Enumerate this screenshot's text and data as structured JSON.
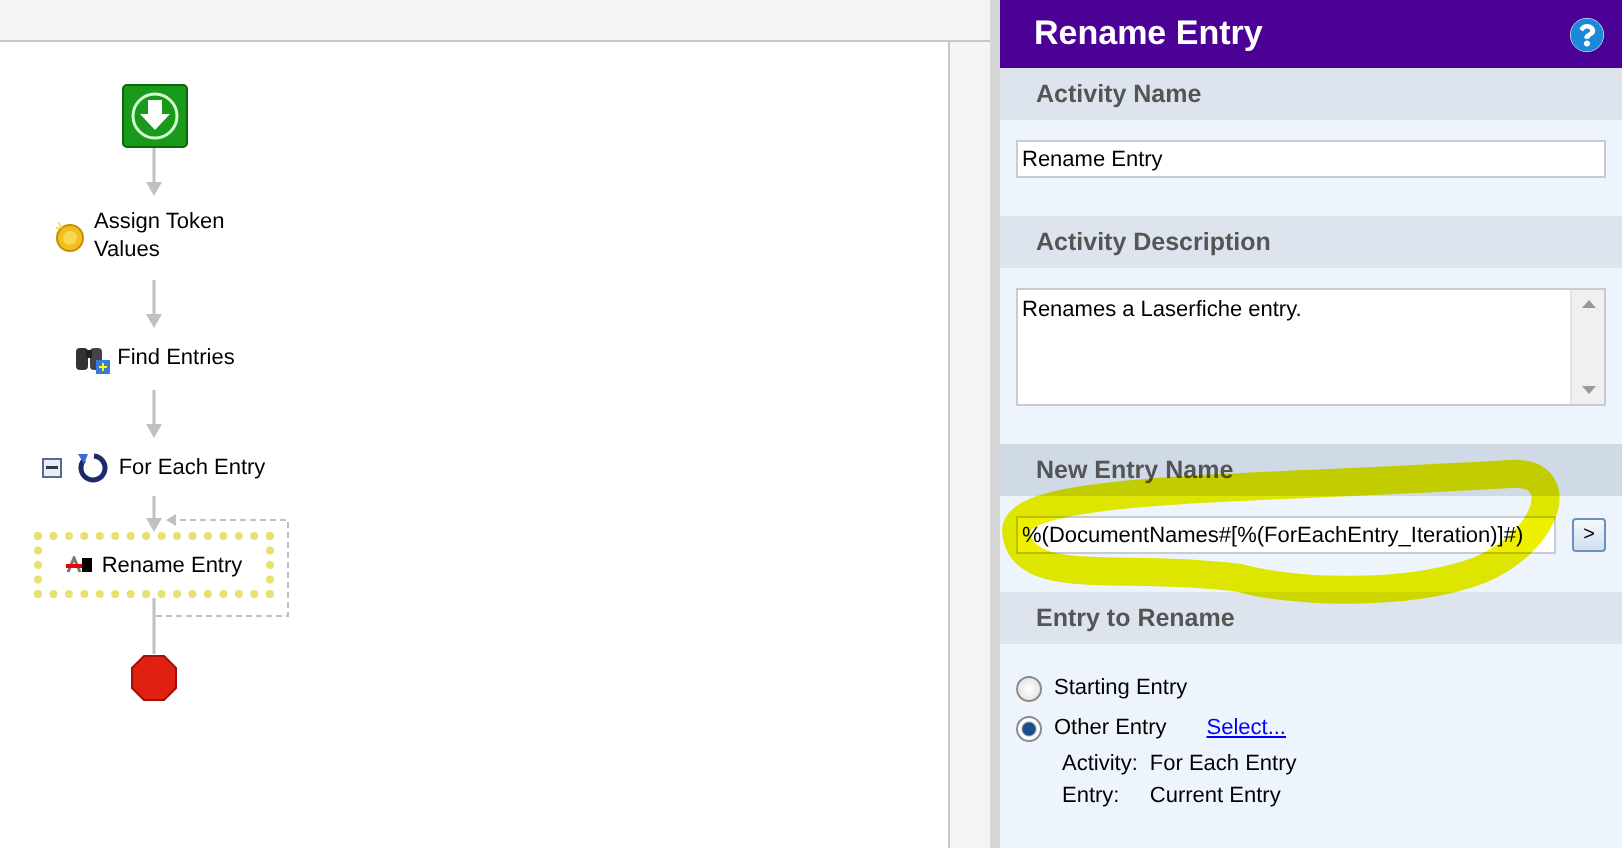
{
  "workflow": [
    {
      "kind": "start"
    },
    {
      "kind": "tokens",
      "label": "Assign Token Values",
      "selected": false
    },
    {
      "kind": "search",
      "label": "Find Entries",
      "selected": false
    },
    {
      "kind": "loop",
      "label": "For Each Entry",
      "expanded": true,
      "selected": false
    },
    {
      "kind": "rename",
      "label": "Rename Entry",
      "selected": true
    },
    {
      "kind": "stop"
    }
  ],
  "properties": {
    "title": "Rename Entry",
    "sections": [
      {
        "kind": "input",
        "heading": "Activity Name",
        "value": "Rename Entry"
      },
      {
        "kind": "textarea",
        "heading": "Activity Description",
        "value": "Renames a Laserfiche entry."
      },
      {
        "kind": "token_input",
        "heading": "New Entry Name",
        "value": "%(DocumentNames#[%(ForEachEntry_Iteration)]#)",
        "button": ">"
      },
      {
        "kind": "choice",
        "heading": "Entry to Rename",
        "options": [
          {
            "label": "Starting Entry",
            "selected": false
          },
          {
            "label": "Other Entry",
            "selected": true,
            "link": "Select..."
          }
        ],
        "details": [
          {
            "label": "Activity:",
            "value": "For Each Entry"
          },
          {
            "label": "Entry:",
            "value": "Current Entry"
          }
        ]
      }
    ]
  }
}
